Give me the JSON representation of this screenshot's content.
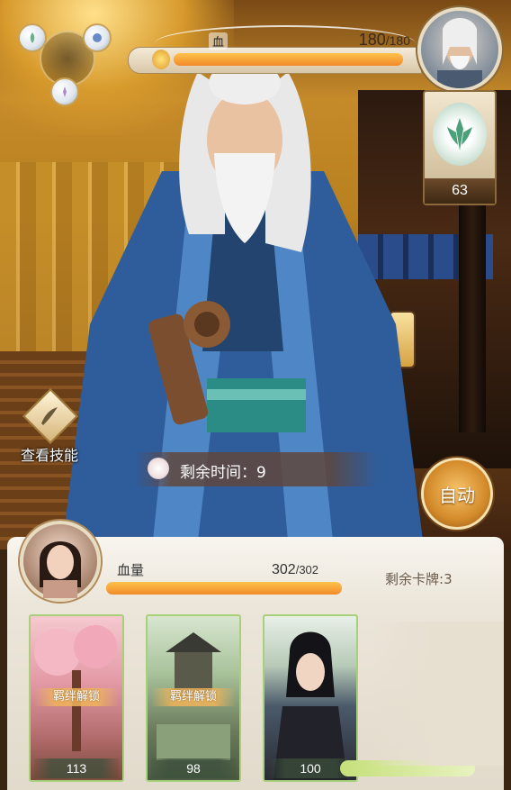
{
  "enemy": {
    "hp_label": "血",
    "hp_current": "180",
    "hp_max": "/180",
    "hp_fraction": 1.0,
    "buff_count": "63"
  },
  "left_panel": {
    "view_skills_label": "查看技能"
  },
  "battle": {
    "remaining_time_label": "剩余时间：",
    "remaining_time_value": "9",
    "auto_button_label": "自动"
  },
  "player": {
    "hp_label": "血量",
    "hp_current": "302",
    "hp_max": "/302",
    "hp_fraction": 1.0,
    "remaining_cards_label": "剩余卡牌:",
    "remaining_cards_value": "3"
  },
  "cards": [
    {
      "lock_label": "羁绊解锁",
      "cost": "113"
    },
    {
      "lock_label": "羁绊解锁",
      "cost": "98"
    },
    {
      "cost": "100"
    }
  ],
  "colors": {
    "hp_fill": "#f08a2a",
    "card_border": "#a7d07a",
    "auto_button": "#d38a2a"
  }
}
